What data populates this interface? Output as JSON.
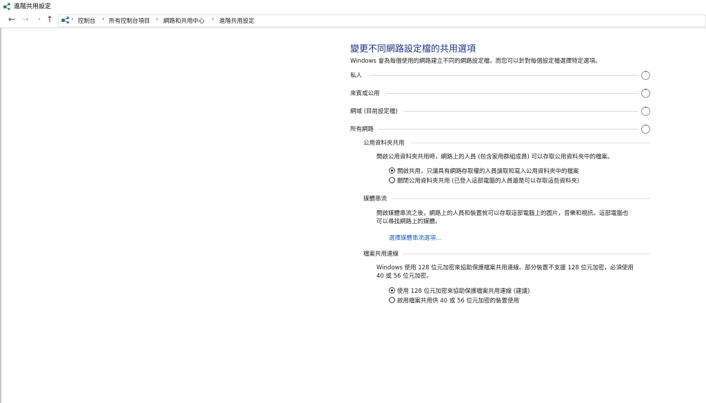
{
  "window": {
    "title": "進階共用設定"
  },
  "nav": {
    "back": "←",
    "forward": "→",
    "recent": "˅",
    "up": "↑"
  },
  "breadcrumb": {
    "sep": "›",
    "items": [
      "控制台",
      "所有控制台項目",
      "網路和共用中心",
      "進階共用設定"
    ]
  },
  "main": {
    "heading": "變更不同網路設定檔的共用選項",
    "description": "Windows 會為每個使用的網路建立不同的網路設定檔，而您可以針對每個設定檔選擇特定選項。",
    "profiles": [
      {
        "label": "私人",
        "expander": "˅"
      },
      {
        "label": "來賓或公用",
        "expander": "˅"
      },
      {
        "label": "網域 (目前設定檔)",
        "expander": "˅"
      },
      {
        "label": "所有網路",
        "expander": "˄"
      }
    ],
    "public_folder": {
      "title": "公用資料夾共用",
      "description": "開啟公用資料夾共用時，網路上的人員 (包含家用群組成員) 可以存取公用資料夾中的檔案。",
      "options": [
        {
          "label": "開啟共用，只讓具有網路存取權的人員讀取和寫入公用資料夾中的檔案",
          "checked": true
        },
        {
          "label": "關閉公用資料夾共用 (已登入這部電腦的人員還是可以存取這些資料夾)",
          "checked": false
        }
      ]
    },
    "media_streaming": {
      "title": "媒體串流",
      "description_line1": "開啟媒體串流之後，網路上的人員和裝置就可以存取這部電腦上的圖片，音樂和視訊。這部電腦也",
      "description_line2": "可以尋找網路上的媒體。",
      "link": "選擇媒體串流選項..."
    },
    "file_sharing": {
      "title": "檔案共用連線",
      "description_line1": "Windows 使用 128 位元加密來協助保護檔案共用連線。部分裝置不支援 128 位元加密，必須使用",
      "description_line2": "40 或 56 位元加密。",
      "options": [
        {
          "label": "使用 128 位元加密來協助保護檔案共用連線 (建議)",
          "checked": true
        },
        {
          "label": "啟用檔案共用供 40 或 56 位元加密的裝置使用",
          "checked": false
        }
      ]
    }
  }
}
